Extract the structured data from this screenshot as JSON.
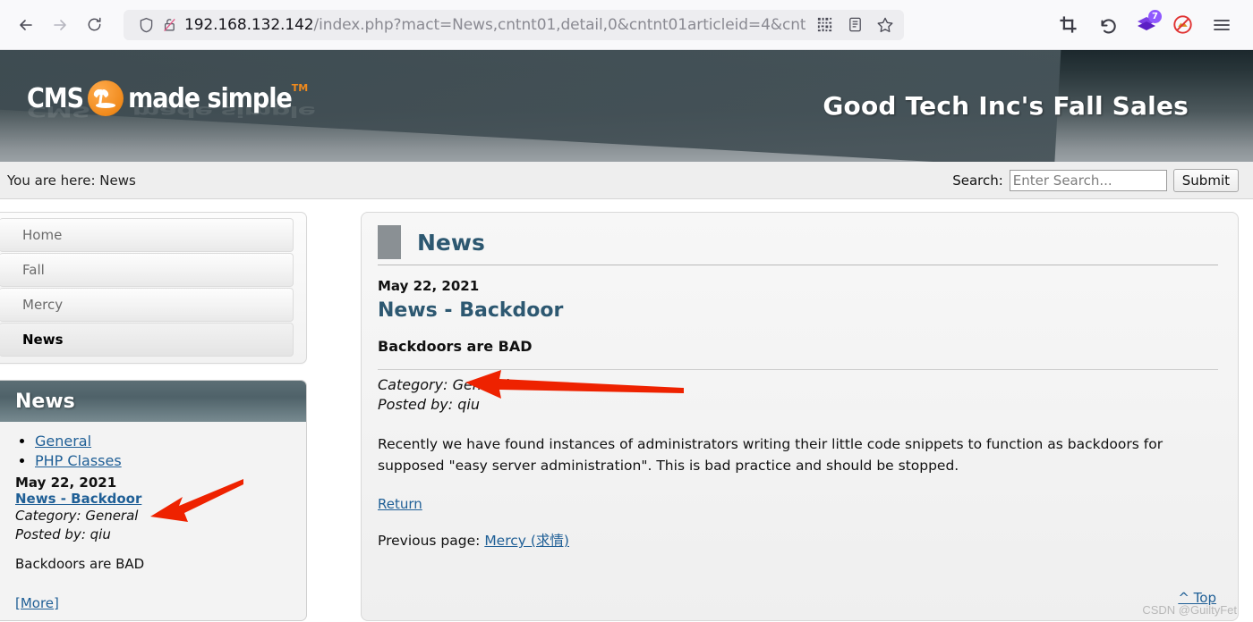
{
  "browser": {
    "back_icon": "back-arrow-icon",
    "forward_icon": "forward-arrow-icon",
    "reload_icon": "reload-icon",
    "shield_icon": "shield-icon",
    "insecure_icon": "broken-lock-icon",
    "url_host": "192.168.132.142",
    "url_path": "/index.php?mact=News,cntnt01,detail,0&cntnt01articleid=4&cntnt",
    "url_full": "192.168.132.142/index.php?mact=News,cntnt01,detail,0&cntnt01articleid=4&cntnt",
    "qr_icon": "qr-code-icon",
    "reader_icon": "reader-mode-icon",
    "bookmark_icon": "star-bookmark-icon",
    "crop_icon": "crop-screenshot-icon",
    "undo_icon": "undo-arrow-icon",
    "stack_icon": "purple-stack-icon",
    "stack_badge": "7",
    "block_icon": "block-ads-icon",
    "menu_icon": "hamburger-menu-icon"
  },
  "header": {
    "logo_cms": "CMS",
    "logo_made_simple": "made simple",
    "logo_tm": "TM",
    "site_title": "Good Tech Inc's Fall Sales"
  },
  "strip": {
    "breadcrumb": "You are here: News",
    "search_label": "Search:",
    "search_value": "",
    "search_placeholder": "Enter Search...",
    "submit_label": "Submit"
  },
  "sidebar": {
    "menu": [
      {
        "label": "Home",
        "active": false
      },
      {
        "label": "Fall",
        "active": false
      },
      {
        "label": "Mercy",
        "active": false
      },
      {
        "label": "News",
        "active": true
      }
    ],
    "news_block": {
      "title": "News",
      "categories": [
        "General",
        "PHP Classes"
      ],
      "date": "May 22, 2021",
      "article_title": "News - Backdoor",
      "category_line": "Category: General",
      "posted_line": "Posted by: qiu",
      "summary": "Backdoors are BAD",
      "more_label": "[More]"
    }
  },
  "main": {
    "section_title": "News",
    "date": "May 22, 2021",
    "title": "News - Backdoor",
    "subtitle": "Backdoors are BAD",
    "category_line": "Category: General",
    "posted_line": "Posted by: qiu",
    "body": "Recently we have found instances of administrators writing their little code snippets to function as backdoors for supposed \"easy server administration\". This is bad practice and should be stopped.",
    "return_label": "Return",
    "previous_label": "Previous page:",
    "previous_link": "Mercy (求情)",
    "top_label": "^ Top"
  },
  "watermark": "CSDN @GuiltyFet",
  "colors": {
    "accent_link": "#1f5f96",
    "heading": "#2d5871",
    "header_dark": "#1c282d",
    "logo_orange": "#f08a1c",
    "badge_purple": "#9059ff",
    "arrow_red": "#ee2200"
  }
}
